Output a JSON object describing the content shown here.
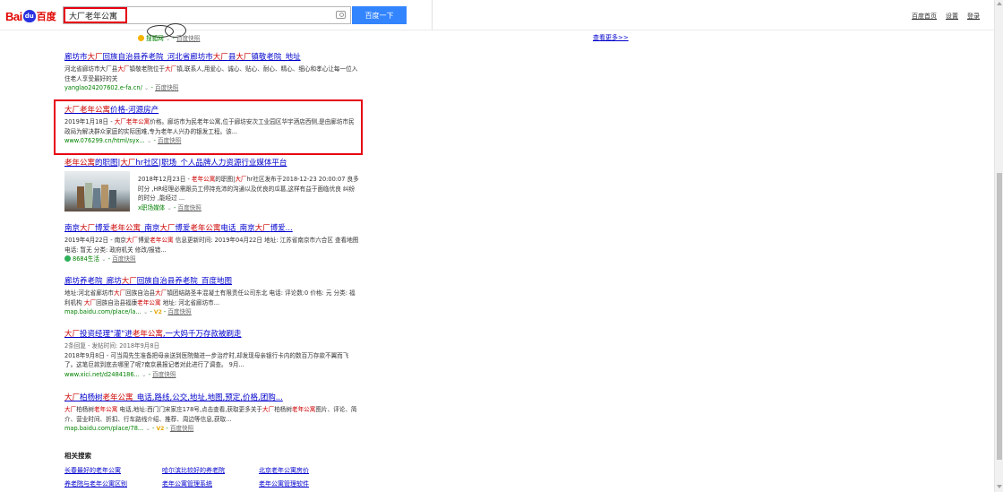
{
  "header": {
    "logo": {
      "bai": "Bai",
      "du": "du",
      "zh": "百度"
    },
    "search_value": "大厂老年公寓",
    "search_button": "百度一下",
    "links": [
      "百度首页",
      "设置",
      "登录"
    ]
  },
  "right": {
    "see_more": "查看更多>>"
  },
  "prev_result": {
    "source": "搜狐网",
    "snapshot": "百度快照"
  },
  "results": [
    {
      "title": [
        [
          "廊坊市",
          false
        ],
        [
          "大厂",
          true
        ],
        [
          "回族自治县养老院_河北省廊坊市",
          false
        ],
        [
          "大厂",
          true
        ],
        [
          "县",
          false
        ],
        [
          "大厂",
          true
        ],
        [
          "镇敬老院_地址",
          false
        ]
      ],
      "abstract": [
        [
          "河北省廊坊市大厂县",
          false
        ],
        [
          "大厂",
          true
        ],
        [
          "镇敬老院位于",
          false
        ],
        [
          "大厂",
          true
        ],
        [
          "镇,联系人,用爱心、诚心、贴心、耐心、精心、细心和孝心让每一位入住老人享受最好的关",
          false
        ]
      ],
      "url": "yanglao24207602.e-fa.cn/",
      "snapshot": "百度快照"
    },
    {
      "title": [
        [
          "大厂老年公寓",
          true
        ],
        [
          "价格-河源房产",
          false
        ]
      ],
      "abstract": [
        [
          "2019年1月18日 - ",
          false
        ],
        [
          "大厂老年公寓",
          true
        ],
        [
          "价格。廊坊市为民老年公寓,位于廊坊安次工业园区华宇酒店西侧,是由廊坊市民政局为解决群众家庭的实际困难,专为老年人兴办的银发工程。该...",
          false
        ]
      ],
      "url": "www.076299.cn/html/syx...",
      "snapshot": "百度快照"
    },
    {
      "title": [
        [
          "老年公寓",
          true
        ],
        [
          "的职图|",
          false
        ],
        [
          "大厂",
          true
        ],
        [
          "hr社区|职场_个人品牌人力资源行业媒体平台",
          false
        ]
      ],
      "abstract": [
        [
          "2018年12月23日 - ",
          false
        ],
        [
          "老年公寓",
          true
        ],
        [
          "的职图|",
          false
        ],
        [
          "大厂",
          true
        ],
        [
          "hr社区发布于2018-12-23 20:00:07 良多时分 ,HR经理必需跟员工停持充沛的沟通以及优良的瓜葛,这样有益于面临优良 纠纷的时分 ,能经过 ...",
          false
        ]
      ],
      "url": "",
      "source": "x职场媒体",
      "snapshot": "百度快照"
    },
    {
      "title": [
        [
          "南京",
          false
        ],
        [
          "大厂",
          true
        ],
        [
          "博爱",
          false
        ],
        [
          "老年公寓",
          true
        ],
        [
          "_南京",
          false
        ],
        [
          "大厂",
          true
        ],
        [
          "博爱",
          false
        ],
        [
          "老年公寓",
          true
        ],
        [
          "电话_南京",
          false
        ],
        [
          "大厂",
          true
        ],
        [
          "博爱...",
          false
        ]
      ],
      "abstract": [
        [
          "2019年4月22日 - 南京",
          false
        ],
        [
          "大厂",
          true
        ],
        [
          "博爱",
          false
        ],
        [
          "老年公寓",
          true
        ],
        [
          " 信息更新时间: 2019年04月22日 地址: 江苏省南京市六合区 查看地图 电话: 暂无 分类: 政府机关 修改/报错...",
          false
        ]
      ],
      "url": "",
      "source": "8684生活",
      "snapshot": "百度快照"
    },
    {
      "title": [
        [
          "廊坊养老院_廊坊",
          false
        ],
        [
          "大厂",
          true
        ],
        [
          "回族自治县养老院_百度地图",
          false
        ]
      ],
      "abstract": [
        [
          "地址:河北省廊坊市",
          false
        ],
        [
          "大厂",
          true
        ],
        [
          "回族自治县",
          false
        ],
        [
          "大厂",
          true
        ],
        [
          "镇团结路圣丰混凝土有限责任公司东北 电话: 评论数:0 价格: 元 分类: 福利机构 ",
          false
        ],
        [
          "大厂",
          true
        ],
        [
          "回族自治县福康",
          false
        ],
        [
          "老年公寓",
          true
        ],
        [
          " 地址: 河北省廊坊市...",
          false
        ]
      ],
      "url": "map.baidu.com/place/la...",
      "badge": "V2",
      "snapshot": "百度快照"
    },
    {
      "title": [
        [
          "大厂",
          true
        ],
        [
          "投资经理\"灌\"进",
          false
        ],
        [
          "老年公寓",
          true
        ],
        [
          ",一大妈千万存款被刷走",
          false
        ]
      ],
      "abstract": [
        [
          "2条回复 - 发帖时间: 2018年9月8日",
          false
        ]
      ],
      "abstract2": [
        [
          "2018年9月8日 - 可当周先生准备把母亲送到医院做进一步治疗时,却发现母亲银行卡内的数百万存款不翼而飞了。这笔巨款到底去哪里了呢?南京晨报记者对此进行了调查。 9月...",
          false
        ]
      ],
      "url": "www.xici.net/d2484186...",
      "snapshot": "百度快照"
    },
    {
      "title": [
        [
          "大厂",
          true
        ],
        [
          "柏杨树",
          false
        ],
        [
          "老年公寓",
          true
        ],
        [
          "_电话,路线,公交,地址,地图,预定,价格,团购...",
          false
        ]
      ],
      "abstract": [
        [
          "大厂",
          true
        ],
        [
          "柏杨树",
          false
        ],
        [
          "老年公寓",
          true
        ],
        [
          " 电话,地址:西门门宋家庄178号,点击查看,获取更多关于",
          false
        ],
        [
          "大厂",
          true
        ],
        [
          "柏杨树",
          false
        ],
        [
          "老年公寓",
          true
        ],
        [
          "图片、评论、简介、营业时间、折扣、行车路线介绍、推荐、周边等信息,获取...",
          false
        ]
      ],
      "url": "map.baidu.com/place/78...",
      "badge": "V2",
      "snapshot": "百度快照"
    }
  ],
  "related": {
    "title": "相关搜索",
    "items": [
      "长春最好的老年公寓",
      "哈尔滨比较好的养老院",
      "北京老年公寓房价",
      "养老院与老年公寓区别",
      "老年公寓管理系统",
      "老年公寓管理软件"
    ]
  }
}
